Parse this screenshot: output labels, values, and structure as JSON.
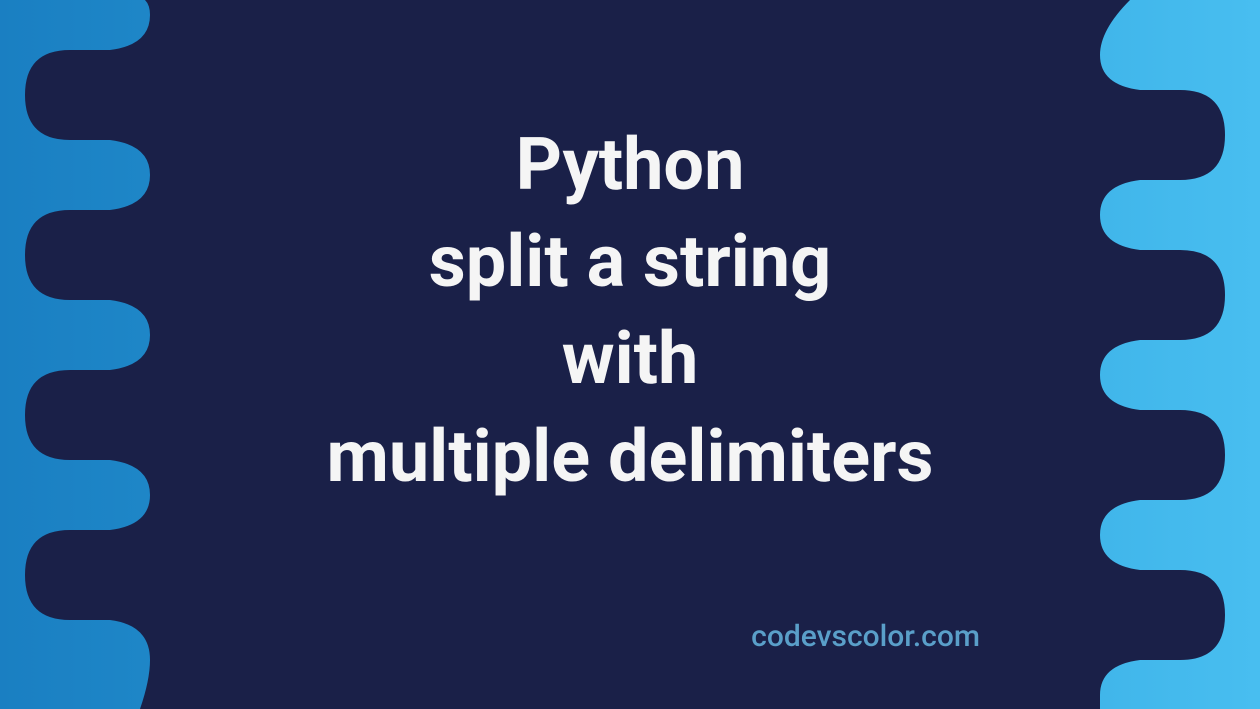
{
  "title": {
    "line1": "Python",
    "line2": "split a string",
    "line3": "with",
    "line4": "multiple delimiters"
  },
  "watermark": "codevscolor.com",
  "colors": {
    "gradient_start": "#1a7fc2",
    "gradient_end": "#48bef0",
    "blob_fill": "#1a2048",
    "text_color": "#f5f5f5",
    "watermark_color": "#5a9fc9"
  }
}
